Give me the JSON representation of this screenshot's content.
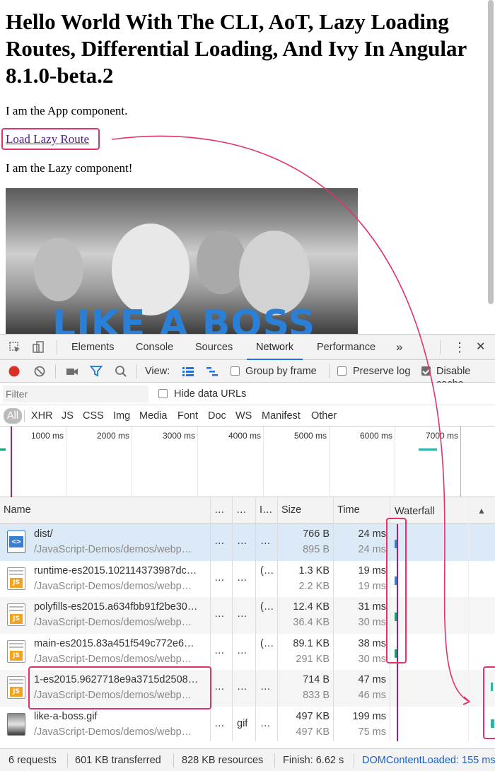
{
  "page": {
    "heading": "Hello World With The CLI, AoT, Lazy Loading Routes, Differential Loading, And Ivy In Angular 8.1.0-beta.2",
    "app_text": "I am the App component.",
    "lazy_link": "Load Lazy Route",
    "lazy_text": "I am the Lazy component!",
    "gif_caption": "LIKE A BOSS"
  },
  "devtools": {
    "tabs": [
      "Elements",
      "Console",
      "Sources",
      "Network",
      "Performance"
    ],
    "active_tab": "Network",
    "more_tabs": "»",
    "menu_icon": "⋮",
    "close_icon": "✕",
    "toolbar": {
      "view_label": "View:",
      "group_by_frame": "Group by frame",
      "preserve_log": "Preserve log",
      "disable_cache": "Disable cache",
      "disable_cache_checked": true
    },
    "filter": {
      "placeholder": "Filter",
      "hide_data_urls": "Hide data URLs"
    },
    "types": [
      "All",
      "XHR",
      "JS",
      "CSS",
      "Img",
      "Media",
      "Font",
      "Doc",
      "WS",
      "Manifest",
      "Other"
    ],
    "timeline_ticks": [
      "1000 ms",
      "2000 ms",
      "3000 ms",
      "4000 ms",
      "5000 ms",
      "6000 ms",
      "7000 ms"
    ],
    "columns": [
      "Name",
      "…",
      "…",
      "I…",
      "Size",
      "Time",
      "Waterfall"
    ],
    "rows": [
      {
        "icon": "html-doc-icon",
        "name": "dist/",
        "path": "/JavaScript-Demos/demos/webp…",
        "c1": "…",
        "c2": "…",
        "c3": "…",
        "size1": "766 B",
        "size2": "895 B",
        "time1": "24 ms",
        "time2": "24 ms"
      },
      {
        "icon": "js-file-icon",
        "name": "runtime-es2015.102114373987dc…",
        "path": "/JavaScript-Demos/demos/webp…",
        "c1": "…",
        "c2": "…",
        "c3": "(…",
        "size1": "1.3 KB",
        "size2": "2.2 KB",
        "time1": "19 ms",
        "time2": "19 ms"
      },
      {
        "icon": "js-file-icon",
        "name": "polyfills-es2015.a634fbb91f2be30…",
        "path": "/JavaScript-Demos/demos/webp…",
        "c1": "…",
        "c2": "…",
        "c3": "(…",
        "size1": "12.4 KB",
        "size2": "36.4 KB",
        "time1": "31 ms",
        "time2": "30 ms"
      },
      {
        "icon": "js-file-icon",
        "name": "main-es2015.83a451f549c772e6…",
        "path": "/JavaScript-Demos/demos/webp…",
        "c1": "…",
        "c2": "…",
        "c3": "(…",
        "size1": "89.1 KB",
        "size2": "291 KB",
        "time1": "38 ms",
        "time2": "30 ms"
      },
      {
        "icon": "js-file-icon",
        "name": "1-es2015.9627718e9a3715d2508…",
        "path": "/JavaScript-Demos/demos/webp…",
        "c1": "…",
        "c2": "…",
        "c3": "…",
        "size1": "714 B",
        "size2": "833 B",
        "time1": "47 ms",
        "time2": "46 ms"
      },
      {
        "icon": "image-file-icon",
        "name": "like-a-boss.gif",
        "path": "/JavaScript-Demos/demos/webp…",
        "c1": "…",
        "c2": "gif",
        "c3": "…",
        "size1": "497 KB",
        "size2": "497 KB",
        "time1": "199 ms",
        "time2": "75 ms"
      }
    ],
    "status": {
      "requests": "6 requests",
      "transferred": "601 KB transferred",
      "resources": "828 KB resources",
      "finish": "Finish: 6.62 s",
      "dom_loaded": "DOMContentLoaded: 155 ms"
    }
  },
  "colors": {
    "highlight": "#e0336b",
    "accent": "#1a73e8",
    "record": "#d93025"
  }
}
